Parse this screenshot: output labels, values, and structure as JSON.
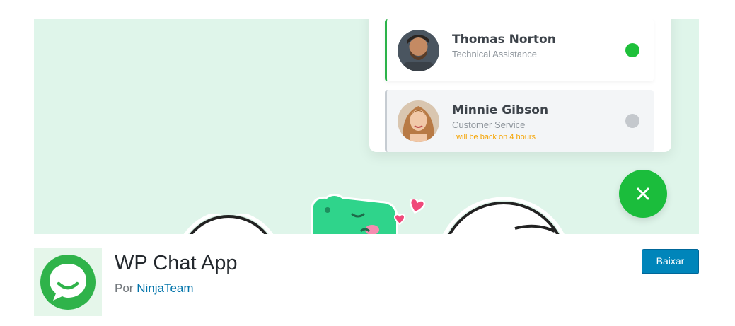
{
  "banner": {
    "agents": [
      {
        "name": "Thomas Norton",
        "role": "Technical Assistance",
        "status": "online"
      },
      {
        "name": "Minnie Gibson",
        "role": "Customer Service",
        "status": "offline",
        "away_message": "I will be back on 4 hours"
      }
    ]
  },
  "plugin": {
    "name": "WP Chat App",
    "author_prefix": "Por",
    "author": "NinjaTeam",
    "download_label": "Baixar"
  },
  "colors": {
    "banner_bg": "#dff5ea",
    "online": "#1ec03a",
    "offline": "#c4c8cd",
    "away_text": "#f5a300",
    "fab": "#1bbd3c",
    "link": "#0073aa",
    "button": "#0085ba"
  }
}
